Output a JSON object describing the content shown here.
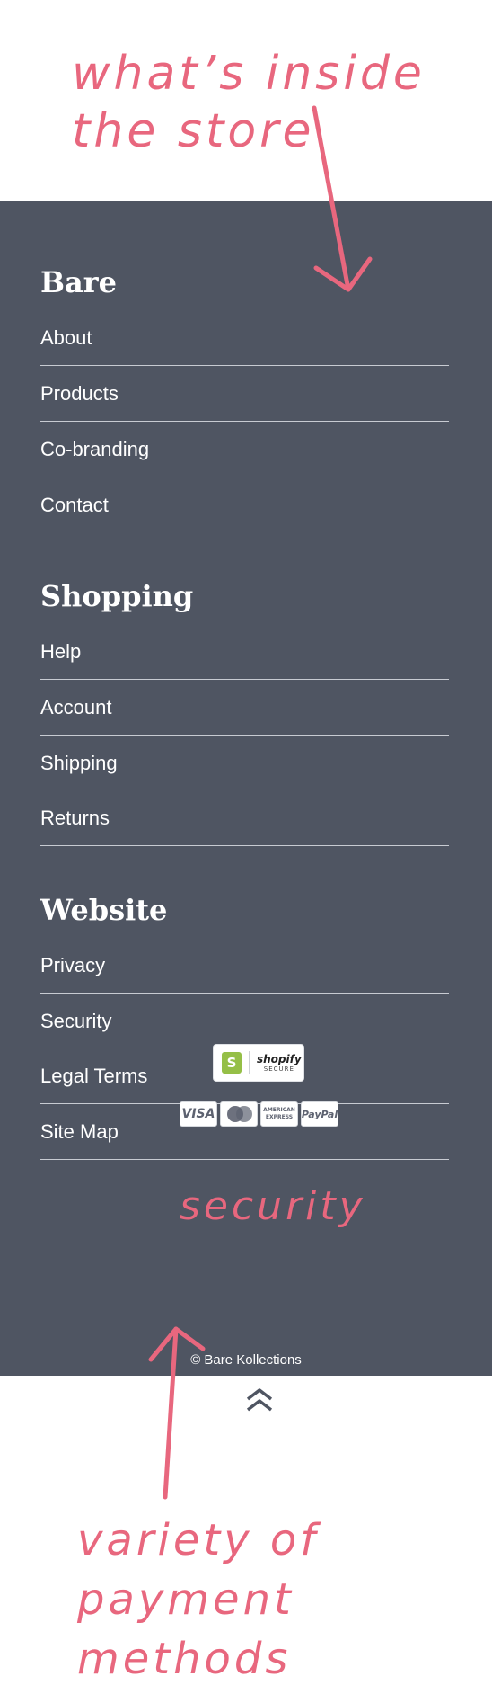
{
  "annotations": {
    "top_line1": "what’s inside",
    "top_line2": "the store",
    "middle": "security",
    "bottom_line1": "variety of",
    "bottom_line2": "payment",
    "bottom_line3": "methods"
  },
  "footer": {
    "sections": [
      {
        "title": "Bare",
        "links": [
          "About",
          "Products",
          "Co-branding",
          "Contact"
        ]
      },
      {
        "title": "Shopping",
        "links": [
          "Help",
          "Account",
          "Shipping",
          "Returns"
        ]
      },
      {
        "title": "Website",
        "links": [
          "Privacy",
          "Security",
          "Legal Terms",
          "Site Map"
        ]
      }
    ],
    "shopify_badge": {
      "brand": "shopify",
      "label": "SECURE",
      "logo_letter": "S"
    },
    "payments": {
      "visa": "VISA",
      "amex_line1": "AMERICAN",
      "amex_line2": "EXPRESS",
      "paypal": "PayPal"
    },
    "copyright": "© Bare Kollections"
  },
  "colors": {
    "footer_bg": "#4f5562",
    "annotation": "#e8677e",
    "shopify_green": "#95bf47"
  }
}
